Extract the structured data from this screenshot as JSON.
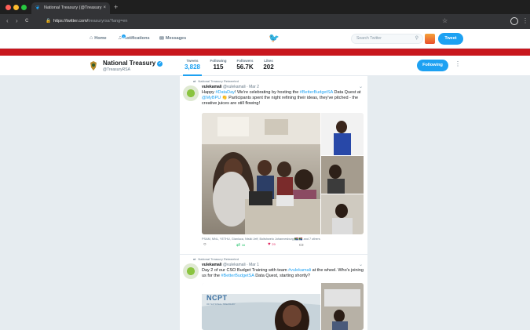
{
  "browser": {
    "tab_title": "National Treasury (@Treasury",
    "tab_close": "×",
    "new_tab": "+",
    "url_host": "https://twitter.com/",
    "url_path": "treasuryrsa?lang=en",
    "back": "‹",
    "forward": "›",
    "reload": "C"
  },
  "twitter_nav": {
    "home": "Home",
    "notifications": "Notifications",
    "notifications_badge": "9",
    "messages": "Messages",
    "search_placeholder": "Search Twitter",
    "tweet_button": "Tweet"
  },
  "profile": {
    "name": "National Treasury",
    "handle": "@TreasuryRSA",
    "stats": [
      {
        "label": "Tweets",
        "value": "3,828"
      },
      {
        "label": "Following",
        "value": "115"
      },
      {
        "label": "Followers",
        "value": "56.7K"
      },
      {
        "label": "Likes",
        "value": "202"
      }
    ],
    "following_button": "Following",
    "more": "⋮"
  },
  "tweets": [
    {
      "retweet_note": "National Treasury Retweeted",
      "author": "vulekamali",
      "handle": "@vulekamali",
      "date": "· Mar 2",
      "text_parts": [
        {
          "t": "Happy ",
          "link": false
        },
        {
          "t": "#DataDay",
          "link": true
        },
        {
          "t": "! We're celebrating by hosting the ",
          "link": false
        },
        {
          "t": "#BetterBudgetSA",
          "link": true
        },
        {
          "t": " Data Quest at ",
          "link": false
        },
        {
          "t": "@MyBPU",
          "link": true
        },
        {
          "t": " 👏 Participants spent the night refining their ideas, they've pitched - the creative juices are still flowing!",
          "link": false
        }
      ],
      "tagline": "PSAM, MNL, YETHU, Gianluca, Ntsiki Jeff, Boitshwelo Johannesburg 🇿🇦 🇿🇦 and 7 others",
      "retweets": "16",
      "likes": "29"
    },
    {
      "retweet_note": "National Treasury Retweeted",
      "author": "vulekamali",
      "handle": "@vulekamali",
      "date": "· Mar 1",
      "text_parts": [
        {
          "t": "Day 2 of our CSO Budget Training with team ",
          "link": false
        },
        {
          "t": "#vulekamali",
          "link": true
        },
        {
          "t": " at the wheel. Who's joining us for the ",
          "link": false
        },
        {
          "t": "#BetterBudgetSA",
          "link": true
        },
        {
          "t": " Data Quest, starting shortly?",
          "link": false
        }
      ],
      "banner_text": "NCPT",
      "banner_sub": "OF NATIONAL TREASURY"
    }
  ],
  "colors": {
    "twitter_blue": "#1da1f2",
    "cover_red": "#c8171e",
    "retweet_green": "#17bf63",
    "like_pink": "#e0245e"
  },
  "icons": {
    "home": "house-icon",
    "notifications": "bell-icon",
    "messages": "envelope-icon",
    "logo": "twitter-bird-icon",
    "search": "magnifier-icon"
  }
}
